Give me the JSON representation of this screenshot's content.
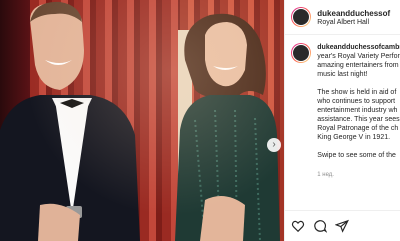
{
  "post": {
    "header": {
      "username": "dukeandduchessof",
      "location": "Royal Albert Hall"
    },
    "caption": {
      "username": "dukeandduchessofcambr",
      "lines": [
        "year's Royal Variety Perfor",
        "amazing entertainers from",
        "music last night!",
        "",
        "The show is held in aid of",
        "who continues to support",
        "entertainment industry wh",
        "assistance. This year sees",
        "Royal Patronage of the ch",
        "King George V in 1921.",
        "",
        "Swipe to see some of the"
      ],
      "time": "1 нед."
    },
    "carousel_next_label": "›"
  }
}
